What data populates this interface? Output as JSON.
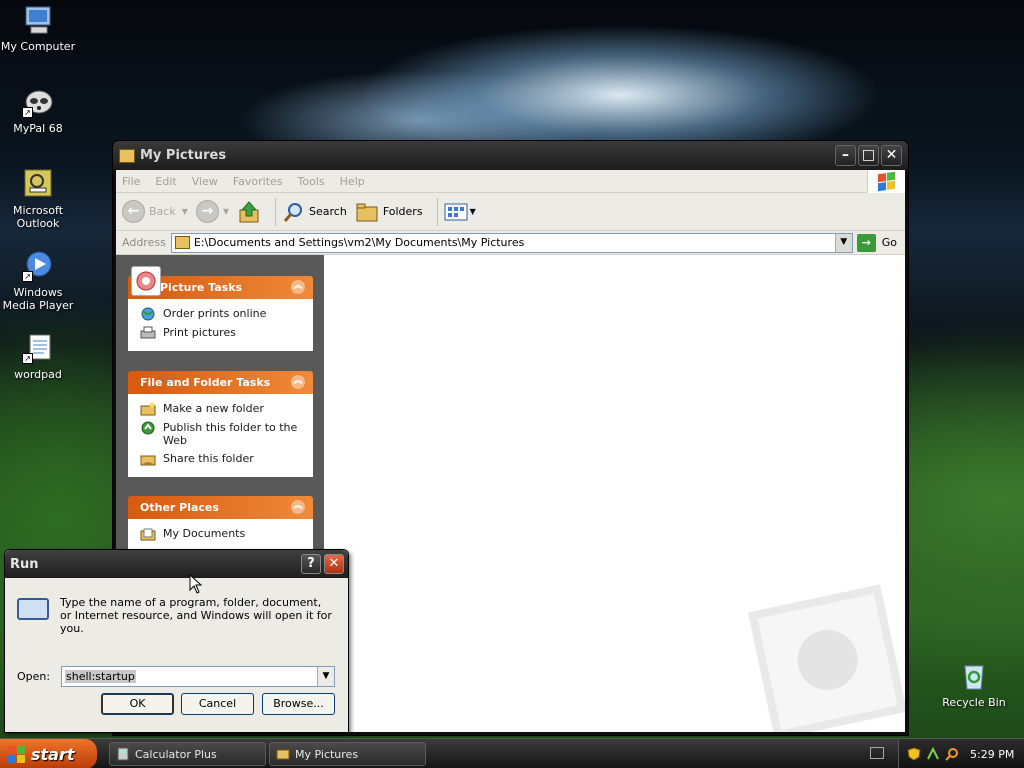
{
  "desktop": {
    "icons": [
      {
        "label": "My Computer",
        "icon": "computer-icon"
      },
      {
        "label": "MyPal 68",
        "icon": "browser-icon"
      },
      {
        "label": "Microsoft Outlook",
        "icon": "outlook-icon"
      },
      {
        "label": "Windows Media Player",
        "icon": "media-player-icon"
      },
      {
        "label": "wordpad",
        "icon": "wordpad-icon"
      },
      {
        "label": "Recycle Bin",
        "icon": "recycle-bin-icon"
      }
    ]
  },
  "explorer": {
    "title": "My Pictures",
    "menu": [
      "File",
      "Edit",
      "View",
      "Favorites",
      "Tools",
      "Help"
    ],
    "toolbar": {
      "back": "Back",
      "search": "Search",
      "folders": "Folders"
    },
    "address": {
      "label": "Address",
      "value": "E:\\Documents and Settings\\vm2\\My Documents\\My Pictures",
      "go": "Go"
    },
    "panels": {
      "picture_tasks": {
        "title": "Picture Tasks",
        "items": [
          "Order prints online",
          "Print pictures"
        ]
      },
      "file_folder_tasks": {
        "title": "File and Folder Tasks",
        "items": [
          "Make a new folder",
          "Publish this folder to the Web",
          "Share this folder"
        ]
      },
      "other_places": {
        "title": "Other Places",
        "items": [
          "My Documents"
        ]
      }
    }
  },
  "run_dialog": {
    "title": "Run",
    "description": "Type the name of a program, folder, document, or Internet resource, and Windows will open it for you.",
    "open_label": "Open:",
    "open_value": "shell:startup",
    "ok": "OK",
    "cancel": "Cancel",
    "browse": "Browse..."
  },
  "taskbar": {
    "start": "start",
    "items": [
      "Calculator Plus",
      "My Pictures"
    ],
    "clock": "5:29 PM"
  },
  "colors": {
    "panel_header": "#e0661e",
    "start_button": "#d9561a",
    "close_button": "#c9401c"
  }
}
